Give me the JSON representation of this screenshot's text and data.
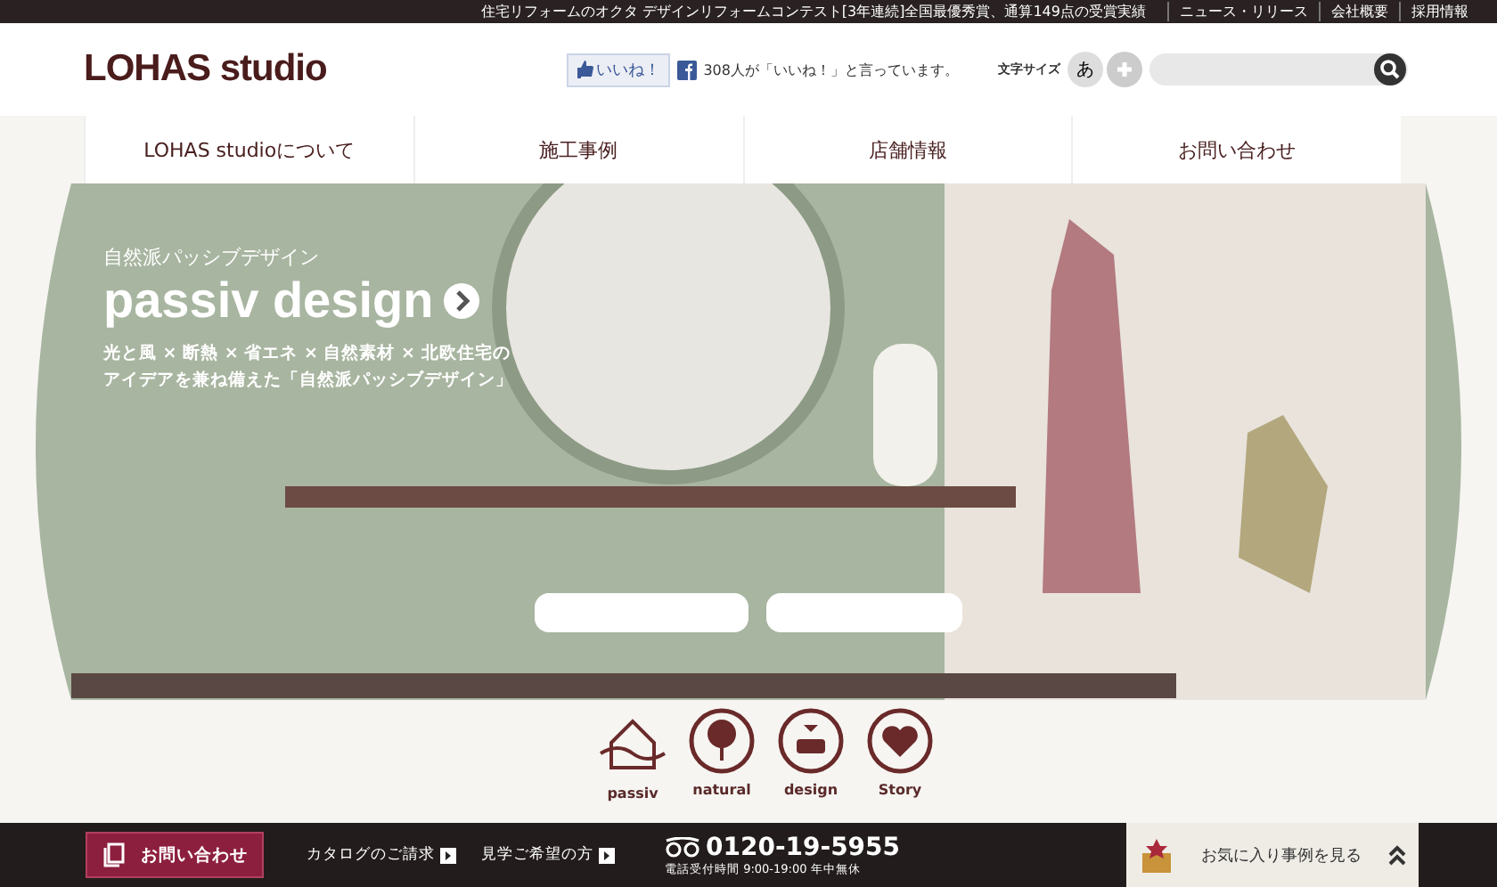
{
  "top_bar": {
    "tagline": "住宅リフォームのオクタ デザインリフォームコンテスト[3年連続]全国最優秀賞、通算149点の受賞実績",
    "links": [
      "ニュース・リリース",
      "会社概要",
      "採用情報"
    ]
  },
  "header": {
    "logo": "LOHAS studio",
    "like_button": "いいね！",
    "like_count": "308人が「いいね！」と言っています。",
    "font_size_label": "文字サイズ",
    "font_size_button": "あ"
  },
  "nav": [
    "LOHAS studioについて",
    "施工事例",
    "店舗情報",
    "お問い合わせ"
  ],
  "hero": {
    "subtitle": "自然派パッシブデザイン",
    "title": "passiv design",
    "description": [
      "光と風 × 断熱 × 省エネ × 自然素材 × 北欧住宅の",
      "アイデアを兼ね備えた「自然派パッシブデザイン」"
    ]
  },
  "features": [
    {
      "kind": "house",
      "label": "passiv"
    },
    {
      "kind": "tree",
      "label": "natural"
    },
    {
      "kind": "sofa",
      "label": "design"
    },
    {
      "kind": "heart",
      "label": "Story"
    }
  ],
  "bottom_bar": {
    "contact_button": "お問い合わせ",
    "links": [
      "カタログのご請求",
      "見学ご希望の方"
    ],
    "phone": "0120-19-5955",
    "hours": "電話受付時間 9:00-19:00 年中無休",
    "favorites": "お気に入り事例を見る"
  }
}
